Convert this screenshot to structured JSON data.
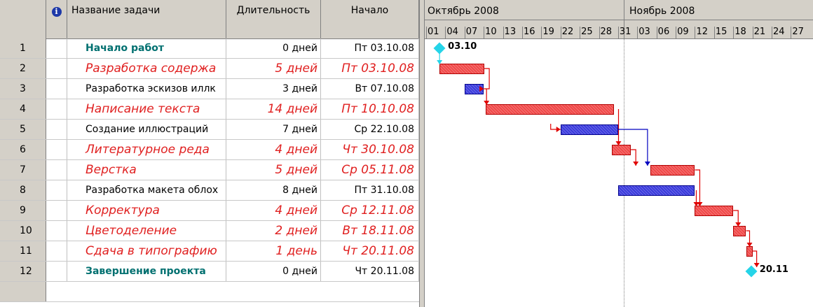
{
  "table": {
    "headers": {
      "id": "",
      "info_icon": "i",
      "name": "Название задачи",
      "duration": "Длительность",
      "start": "Начало"
    },
    "rows": [
      {
        "id": "1",
        "name": "Начало работ",
        "duration": "0 дней",
        "start": "Пт 03.10.08",
        "style": "milestone"
      },
      {
        "id": "2",
        "name": "Разработка содержа",
        "duration": "5 дней",
        "start": "Пт 03.10.08",
        "style": "critical"
      },
      {
        "id": "3",
        "name": "Разработка эскизов иллк",
        "duration": "3 дней",
        "start": "Вт 07.10.08",
        "style": "normal"
      },
      {
        "id": "4",
        "name": "Написание текста",
        "duration": "14 дней",
        "start": "Пт 10.10.08",
        "style": "critical"
      },
      {
        "id": "5",
        "name": "Создание иллюстраций",
        "duration": "7 дней",
        "start": "Ср 22.10.08",
        "style": "normal"
      },
      {
        "id": "6",
        "name": "Литературное реда",
        "duration": "4 дней",
        "start": "Чт 30.10.08",
        "style": "critical"
      },
      {
        "id": "7",
        "name": "Верстка",
        "duration": "5 дней",
        "start": "Ср 05.11.08",
        "style": "critical"
      },
      {
        "id": "8",
        "name": "Разработка макета облох",
        "duration": "8 дней",
        "start": "Пт 31.10.08",
        "style": "normal"
      },
      {
        "id": "9",
        "name": "Корректура",
        "duration": "4 дней",
        "start": "Ср 12.11.08",
        "style": "critical"
      },
      {
        "id": "10",
        "name": "Цветоделение",
        "duration": "2 дней",
        "start": "Вт 18.11.08",
        "style": "critical"
      },
      {
        "id": "11",
        "name": "Сдача в типографию",
        "duration": "1 день",
        "start": "Чт 20.11.08",
        "style": "critical"
      },
      {
        "id": "12",
        "name": "Завершение проекта",
        "duration": "0 дней",
        "start": "Чт 20.11.08",
        "style": "milestone"
      }
    ]
  },
  "gantt": {
    "months": [
      "Октябрь 2008",
      "Ноябрь 2008"
    ],
    "days": [
      "01",
      "04",
      "07",
      "10",
      "13",
      "16",
      "19",
      "22",
      "25",
      "28",
      "31",
      "03",
      "06",
      "09",
      "12",
      "15",
      "18",
      "21",
      "24",
      "27"
    ],
    "milestone_labels": {
      "start": "03.10",
      "end": "20.11"
    },
    "colors": {
      "critical": "#f04848",
      "normal": "#3a3adc",
      "milestone": "#25d4e8",
      "link_critical": "#e00000",
      "link_normal": "#0000c0"
    }
  }
}
